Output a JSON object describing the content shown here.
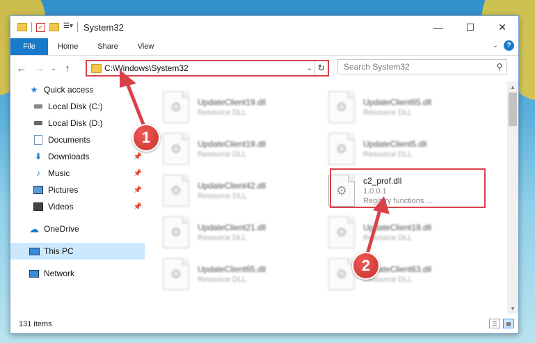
{
  "window": {
    "title": "System32"
  },
  "window_controls": {
    "minimize": "—",
    "maximize": "☐",
    "close": "✕"
  },
  "ribbon": {
    "tabs": [
      "File",
      "Home",
      "Share",
      "View"
    ],
    "help": "?"
  },
  "address": {
    "path": "C:\\Windows\\System32",
    "refresh": "↻"
  },
  "search": {
    "placeholder": "Search System32"
  },
  "sidebar": {
    "items": [
      {
        "label": "Quick access",
        "icon": "star-icon",
        "pinned": false
      },
      {
        "label": "Local Disk (C:)",
        "icon": "drive-icon",
        "pinned": false
      },
      {
        "label": "Local Disk (D:)",
        "icon": "drive-icon",
        "pinned": false
      },
      {
        "label": "Documents",
        "icon": "documents-icon",
        "pinned": false
      },
      {
        "label": "Downloads",
        "icon": "download-icon",
        "pinned": true
      },
      {
        "label": "Music",
        "icon": "music-icon",
        "pinned": true
      },
      {
        "label": "Pictures",
        "icon": "pictures-icon",
        "pinned": true
      },
      {
        "label": "Videos",
        "icon": "videos-icon",
        "pinned": true
      },
      {
        "label": "OneDrive",
        "icon": "cloud-icon",
        "pinned": false
      },
      {
        "label": "This PC",
        "icon": "computer-icon",
        "pinned": false,
        "selected": true
      },
      {
        "label": "Network",
        "icon": "network-icon",
        "pinned": false
      }
    ]
  },
  "files": [
    {
      "name": "UpdateClient19.dll",
      "desc": "Resource DLL"
    },
    {
      "name": "UpdateClient65.dll",
      "desc": "Resource DLL"
    },
    {
      "name": "UpdateClient19.dll",
      "desc": "Resource DLL"
    },
    {
      "name": "UpdateClient5.dll",
      "desc": "Resource DLL"
    },
    {
      "name": "UpdateClient42.dll",
      "desc": "Resource DLL"
    },
    {
      "name": "c2_prof.dll",
      "version": "1.0.0.1",
      "desc": "Registry functions ..."
    },
    {
      "name": "UpdateClient21.dll",
      "desc": "Resource DLL"
    },
    {
      "name": "UpdateClient19.dll",
      "desc": "Resource DLL"
    },
    {
      "name": "UpdateClient65.dll",
      "desc": "Resource DLL"
    },
    {
      "name": "UpdateClient63.dll",
      "desc": "Resource DLL"
    }
  ],
  "status": {
    "item_count": "131 items"
  },
  "annotations": {
    "badge1": "1",
    "badge2": "2"
  },
  "colors": {
    "highlight": "#d9414a",
    "accent": "#1979ca",
    "selected": "#cce8ff"
  }
}
